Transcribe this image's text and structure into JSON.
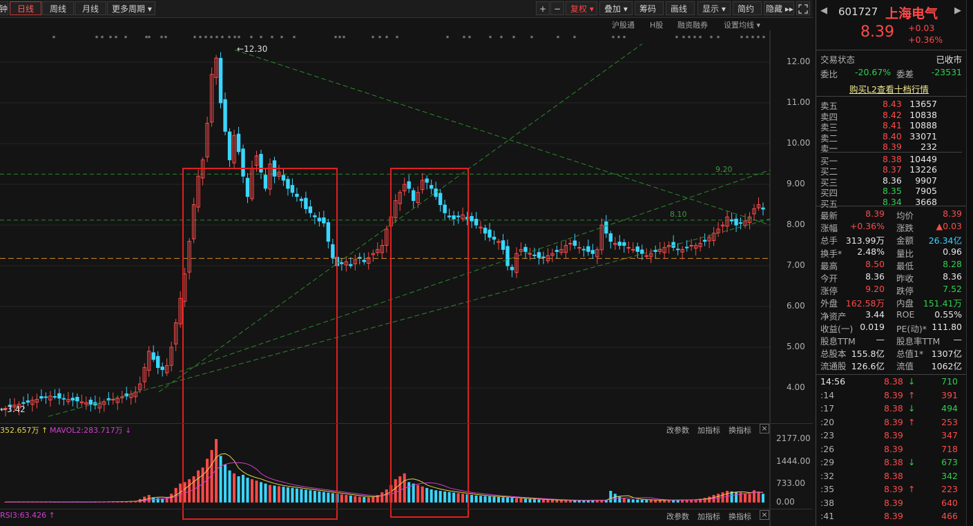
{
  "toolbar": {
    "left_cut": "钟",
    "tabs": [
      "日线",
      "周线",
      "月线",
      "更多周期 ▾"
    ],
    "right_buttons": [
      "+",
      "−",
      "复权 ▾",
      "叠加 ▾",
      "筹码",
      "画线",
      "显示 ▾",
      "简约",
      "隐藏 ▸▸"
    ],
    "fullscreen_icon": "fullscreen-icon"
  },
  "subbar": [
    "沪股通",
    "H股",
    "融资融券",
    "设置均线 ▾"
  ],
  "chart_data": {
    "type": "candlestick",
    "y_ticks": [
      "12.00",
      "11.00",
      "10.00",
      "9.00",
      "8.00",
      "7.00",
      "6.00",
      "5.00",
      "4.00"
    ],
    "ylim": [
      3.3,
      12.9
    ],
    "high_annotation": "12.30",
    "low_annotation": "3.42",
    "ref_lines": [
      "9.20",
      "8.10"
    ],
    "volume_ticks": [
      "2177.00",
      "1444.00",
      "733.00",
      "0.00"
    ],
    "volume_header": {
      "mavol1": "352.657万 ↑",
      "mavol2": "MAVOL2:283.717万 ↓"
    },
    "rsi_header": "RSI3:63.426 ↑",
    "panel_controls": [
      "改参数",
      "加指标",
      "换指标"
    ],
    "closes": [
      3.5,
      3.55,
      3.58,
      3.6,
      3.62,
      3.65,
      3.7,
      3.72,
      3.75,
      3.78,
      3.8,
      3.78,
      3.75,
      3.74,
      3.72,
      3.7,
      3.68,
      3.66,
      3.64,
      3.6,
      3.58,
      3.62,
      3.66,
      3.7,
      3.72,
      3.74,
      3.78,
      3.8,
      3.85,
      3.9,
      4.1,
      4.5,
      4.9,
      4.7,
      4.5,
      4.45,
      4.55,
      5.0,
      5.6,
      6.2,
      6.8,
      7.6,
      8.5,
      9.2,
      9.6,
      10.5,
      11.7,
      12.1,
      11.0,
      10.3,
      9.6,
      10.2,
      9.8,
      9.2,
      8.7,
      9.4,
      9.7,
      9.3,
      8.9,
      9.5,
      9.2,
      9.3,
      9.1,
      8.9,
      8.8,
      8.7,
      8.6,
      8.4,
      8.3,
      8.2,
      8.1,
      8.05,
      7.6,
      7.2,
      7.0,
      7.05,
      7.1,
      7.0,
      7.15,
      7.2,
      7.1,
      7.2,
      7.3,
      7.4,
      7.5,
      7.9,
      8.2,
      8.6,
      8.8,
      9.0,
      8.9,
      8.6,
      8.8,
      9.1,
      9.05,
      8.9,
      8.7,
      8.5,
      8.3,
      8.2,
      8.15,
      8.2,
      8.25,
      8.15,
      8.1,
      8.0,
      7.95,
      7.8,
      7.7,
      7.65,
      7.6,
      7.4,
      7.0,
      6.9,
      7.3,
      7.4,
      7.35,
      7.3,
      7.25,
      7.2,
      7.2,
      7.25,
      7.3,
      7.35,
      7.4,
      7.5,
      7.55,
      7.5,
      7.45,
      7.4,
      7.35,
      7.3,
      7.4,
      8.0,
      7.8,
      7.6,
      7.55,
      7.5,
      7.5,
      7.45,
      7.4,
      7.35,
      7.3,
      7.25,
      7.3,
      7.35,
      7.4,
      7.45,
      7.5,
      7.45,
      7.4,
      7.4,
      7.45,
      7.5,
      7.5,
      7.55,
      7.6,
      7.7,
      7.8,
      7.9,
      8.0,
      8.2,
      8.1,
      8.0,
      8.05,
      8.1,
      8.2,
      8.4,
      8.5,
      8.39
    ],
    "volumes": [
      20,
      18,
      22,
      25,
      20,
      18,
      19,
      21,
      23,
      20,
      18,
      17,
      19,
      20,
      22,
      21,
      19,
      18,
      20,
      22,
      24,
      26,
      28,
      30,
      32,
      35,
      40,
      45,
      50,
      60,
      120,
      200,
      260,
      180,
      150,
      140,
      160,
      300,
      500,
      650,
      700,
      800,
      900,
      1100,
      1200,
      1500,
      1800,
      2177,
      1600,
      1300,
      1100,
      1000,
      900,
      950,
      850,
      800,
      750,
      700,
      650,
      600,
      580,
      560,
      540,
      520,
      500,
      480,
      460,
      440,
      420,
      400,
      380,
      360,
      340,
      320,
      300,
      280,
      260,
      240,
      220,
      200,
      190,
      180,
      200,
      260,
      350,
      450,
      600,
      800,
      900,
      1000,
      700,
      650,
      600,
      550,
      500,
      450,
      420,
      400,
      380,
      360,
      340,
      320,
      300,
      280,
      260,
      240,
      230,
      220,
      210,
      200,
      190,
      180,
      170,
      160,
      150,
      140,
      130,
      120,
      110,
      100,
      95,
      90,
      85,
      80,
      75,
      70,
      70,
      72,
      74,
      76,
      78,
      80,
      82,
      85,
      90,
      400,
      300,
      200,
      150,
      120,
      110,
      100,
      95,
      90,
      85,
      80,
      80,
      82,
      85,
      88,
      90,
      92,
      95,
      100,
      110,
      130,
      160,
      200,
      260,
      300,
      350,
      400,
      380,
      360,
      340,
      320,
      300,
      420,
      380,
      300
    ]
  },
  "right_panel": {
    "code": "601727",
    "name": "上海电气",
    "price": "8.39",
    "change": "+0.03",
    "change_pct": "+0.36%",
    "status_label": "交易状态",
    "status_value": "已收市",
    "weibi_label": "委比",
    "weibi_value": "-20.67%",
    "weicha_label": "委差",
    "weicha_value": "-23531",
    "l2_link": "购买L2查看十档行情",
    "asks": [
      {
        "label": "卖五",
        "price": "8.43",
        "vol": "13657"
      },
      {
        "label": "卖四",
        "price": "8.42",
        "vol": "10838"
      },
      {
        "label": "卖三",
        "price": "8.41",
        "vol": "10888"
      },
      {
        "label": "卖二",
        "price": "8.40",
        "vol": "33071"
      },
      {
        "label": "卖一",
        "price": "8.39",
        "vol": "232"
      }
    ],
    "bids": [
      {
        "label": "买一",
        "price": "8.38",
        "vol": "10449"
      },
      {
        "label": "买二",
        "price": "8.37",
        "vol": "13226"
      },
      {
        "label": "买三",
        "price": "8.36",
        "vol": "9907"
      },
      {
        "label": "买四",
        "price": "8.35",
        "vol": "7905"
      },
      {
        "label": "买五",
        "price": "8.34",
        "vol": "3668"
      }
    ],
    "stats": [
      {
        "l1": "最新",
        "v1": "8.39",
        "c1": "red",
        "l2": "均价",
        "v2": "8.39",
        "c2": "red"
      },
      {
        "l1": "涨幅",
        "v1": "+0.36%",
        "c1": "red",
        "l2": "涨跌",
        "v2": "▲0.03",
        "c2": "red"
      },
      {
        "l1": "总手",
        "v1": "313.99万",
        "c1": "white",
        "l2": "金额",
        "v2": "26.34亿",
        "c2": "cyan"
      },
      {
        "l1": "换手*",
        "v1": "2.48%",
        "c1": "white",
        "l2": "量比",
        "v2": "0.96",
        "c2": "white"
      },
      {
        "l1": "最高",
        "v1": "8.50",
        "c1": "red",
        "l2": "最低",
        "v2": "8.28",
        "c2": "green"
      },
      {
        "l1": "今开",
        "v1": "8.36",
        "c1": "white",
        "l2": "昨收",
        "v2": "8.36",
        "c2": "white"
      },
      {
        "l1": "涨停",
        "v1": "9.20",
        "c1": "red",
        "l2": "跌停",
        "v2": "7.52",
        "c2": "green"
      },
      {
        "l1": "外盘",
        "v1": "162.58万",
        "c1": "red",
        "l2": "内盘",
        "v2": "151.41万",
        "c2": "green"
      },
      {
        "l1": "净资产",
        "v1": "3.44",
        "c1": "white",
        "l2": "ROE",
        "v2": "0.55%",
        "c2": "white"
      },
      {
        "l1": "收益(一)",
        "v1": "0.019",
        "c1": "white",
        "l2": "PE(动)*",
        "v2": "111.80",
        "c2": "white"
      },
      {
        "l1": "股息TTM",
        "v1": "—",
        "c1": "white",
        "l2": "股息率TTM",
        "v2": "—",
        "c2": "white"
      },
      {
        "l1": "总股本",
        "v1": "155.8亿",
        "c1": "white",
        "l2": "总值1*",
        "v2": "1307亿",
        "c2": "white"
      },
      {
        "l1": "流通股",
        "v1": "126.6亿",
        "c1": "white",
        "l2": "流值",
        "v2": "1062亿",
        "c2": "white"
      }
    ],
    "ticks": [
      {
        "t": "14:56",
        "p": "8.38",
        "a": "↓",
        "v": "710",
        "vc": "green"
      },
      {
        "t": ":14",
        "p": "8.39",
        "a": "↑",
        "v": "391",
        "vc": "red"
      },
      {
        "t": ":17",
        "p": "8.38",
        "a": "↓",
        "v": "494",
        "vc": "green"
      },
      {
        "t": ":20",
        "p": "8.39",
        "a": "↑",
        "v": "253",
        "vc": "red"
      },
      {
        "t": ":23",
        "p": "8.39",
        "a": "",
        "v": "347",
        "vc": "red"
      },
      {
        "t": ":26",
        "p": "8.39",
        "a": "",
        "v": "718",
        "vc": "red"
      },
      {
        "t": ":29",
        "p": "8.38",
        "a": "↓",
        "v": "673",
        "vc": "green"
      },
      {
        "t": ":32",
        "p": "8.38",
        "a": "",
        "v": "342",
        "vc": "green"
      },
      {
        "t": ":35",
        "p": "8.39",
        "a": "↑",
        "v": "223",
        "vc": "red"
      },
      {
        "t": ":38",
        "p": "8.39",
        "a": "",
        "v": "640",
        "vc": "red"
      },
      {
        "t": ":41",
        "p": "8.39",
        "a": "",
        "v": "466",
        "vc": "red"
      }
    ]
  }
}
